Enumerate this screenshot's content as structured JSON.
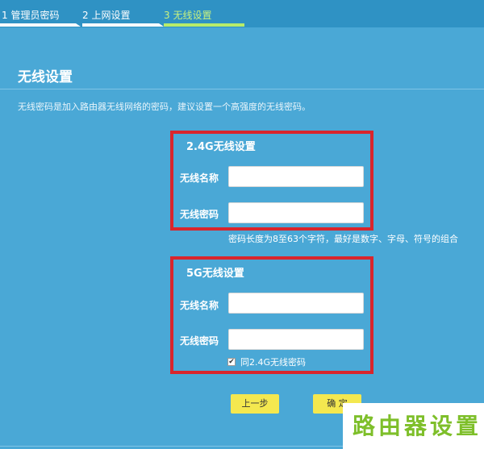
{
  "steps": [
    {
      "label": "1 管理员密码"
    },
    {
      "label": "2 上网设置"
    },
    {
      "label": "3 无线设置"
    }
  ],
  "page": {
    "title": "无线设置",
    "description": "无线密码是加入路由器无线网络的密码，建议设置一个高强度的无线密码。"
  },
  "wifi24": {
    "title": "2.4G无线设置",
    "name_label": "无线名称",
    "name_value": "",
    "password_label": "无线密码",
    "password_value": "",
    "hint": "密码长度为8至63个字符，最好是数字、字母、符号的组合"
  },
  "wifi5": {
    "title": "5G无线设置",
    "name_label": "无线名称",
    "name_value": "",
    "password_label": "无线密码",
    "password_value": "",
    "same_password_label": "同2.4G无线密码",
    "same_password_checked": true
  },
  "buttons": {
    "prev": "上一步",
    "confirm": "确 定"
  },
  "watermark": "路由器设置",
  "colors": {
    "background": "#4aa8d6",
    "highlight_box": "#d9252c",
    "button": "#f4e84f",
    "active_step": "#b7ec6a"
  }
}
